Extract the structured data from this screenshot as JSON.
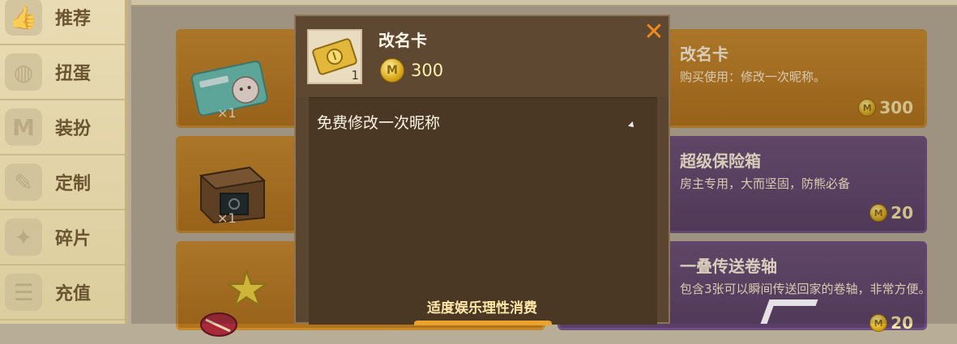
{
  "sidebar": {
    "items": [
      {
        "label": "推荐",
        "icon": "thumbs-up-icon"
      },
      {
        "label": "扭蛋",
        "icon": "capsule-icon"
      },
      {
        "label": "装扮",
        "icon": "shirt-icon"
      },
      {
        "label": "定制",
        "icon": "pencil-icon"
      },
      {
        "label": "碎片",
        "icon": "puzzle-icon"
      },
      {
        "label": "充值",
        "icon": "coins-icon"
      }
    ]
  },
  "cards": [
    {
      "qty": "×1"
    },
    {
      "title": "改名卡",
      "desc": "购买使用：修改一次昵称。",
      "price": "300"
    },
    {
      "qty": "×1"
    },
    {
      "title": "超级保险箱",
      "desc": "房主专用，大而坚固，防熊必备",
      "price": "20"
    },
    {
      "title": "一叠传送卷轴",
      "desc": "包含3张可以瞬间传送回家的卷轴，非常方便。",
      "price": "20"
    }
  ],
  "modal": {
    "title": "改名卡",
    "item_count": "1",
    "price": "300",
    "close_label": "✕",
    "description": "免费修改一次昵称",
    "footer_note": "适度娱乐理性消费"
  },
  "colors": {
    "orange_card": "#c98a2d",
    "purple_card": "#6b5079",
    "modal_bg": "#5a4530",
    "close_accent": "#f08a1c"
  }
}
